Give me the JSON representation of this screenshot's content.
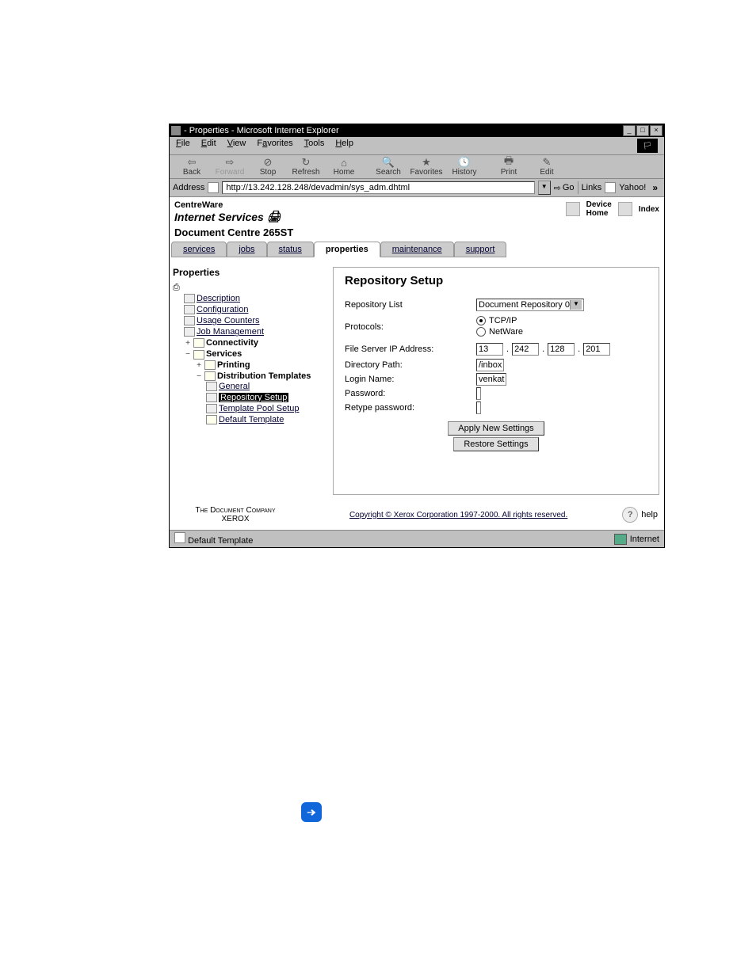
{
  "window": {
    "title": "- Properties - Microsoft Internet Explorer"
  },
  "menubar": {
    "file": "File",
    "edit": "Edit",
    "view": "View",
    "favorites": "Favorites",
    "tools": "Tools",
    "help": "Help"
  },
  "toolbar": {
    "back": "Back",
    "forward": "Forward",
    "stop": "Stop",
    "refresh": "Refresh",
    "home": "Home",
    "search": "Search",
    "favorites": "Favorites",
    "history": "History",
    "print": "Print",
    "editbtn": "Edit"
  },
  "addressbar": {
    "label": "Address",
    "url": "http://13.242.128.248/devadmin/sys_adm.dhtml",
    "go": "Go",
    "links": "Links",
    "yahoo": "Yahoo!"
  },
  "brand": {
    "line1": "CentreWare",
    "line2": "Internet Services",
    "line3": "Document Centre 265ST"
  },
  "headlinks": {
    "device": "Device",
    "home": "Home",
    "index": "Index"
  },
  "tabs": {
    "services": "services",
    "jobs": "jobs",
    "status": "status",
    "properties": "properties",
    "maintenance": "maintenance",
    "support": "support"
  },
  "sidebar": {
    "heading": "Properties",
    "items": {
      "description": "Description",
      "configuration": "Configuration",
      "usage": "Usage Counters",
      "jobmgmt": "Job Management",
      "connectivity": "Connectivity",
      "services": "Services",
      "printing": "Printing",
      "dist": "Distribution Templates",
      "general": "General",
      "repo": "Repository Setup",
      "tpool": "Template Pool Setup",
      "deftpl": "Default Template"
    }
  },
  "form": {
    "heading": "Repository Setup",
    "labels": {
      "repolist": "Repository List",
      "protocols": "Protocols:",
      "fileserver": "File Server IP Address:",
      "dirpath": "Directory Path:",
      "login": "Login Name:",
      "password": "Password:",
      "retype": "Retype password:"
    },
    "values": {
      "repolist_sel": "Document Repository 0",
      "proto_tcpip": "TCP/IP",
      "proto_netware": "NetWare",
      "ip1": "13",
      "ip2": "242",
      "ip3": "128",
      "ip4": "201",
      "dirpath": "/inbox",
      "login": "venkat",
      "password": "",
      "retype": ""
    },
    "buttons": {
      "apply": "Apply New Settings",
      "restore": "Restore Settings"
    }
  },
  "footer": {
    "company1": "The Document Company",
    "company2": "XEROX",
    "copyright": "Copyright © Xerox Corporation 1997-2000. All rights reserved.",
    "help": "help"
  },
  "statusbar": {
    "left": "Default Template",
    "zone": "Internet"
  }
}
